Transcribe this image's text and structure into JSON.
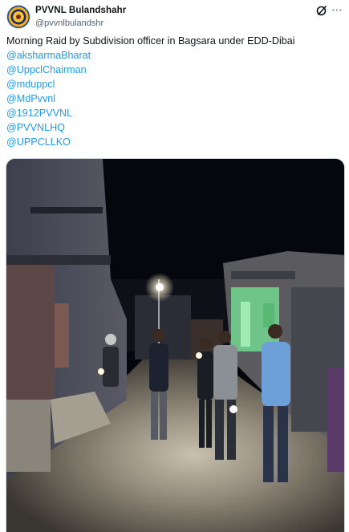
{
  "post": {
    "display_name": "PVVNL Bulandshahr",
    "handle": "@pvvnlbulandshr",
    "text": "Morning Raid by Subdivision officer in Bagsara under EDD-Dibai",
    "mentions": [
      "@aksharmaBharat",
      "@UppclChairman",
      "@mduppcl",
      "@MdPvvnl",
      "@1912PVVNL",
      "@PVVNLHQ",
      "@UPPCLLKO"
    ],
    "more_label": "⋯"
  },
  "icons": {
    "avatar": "pvvnl-logo",
    "grok": "grok-icon",
    "more": "more-icon"
  },
  "colors": {
    "link": "#1d9bf0",
    "text": "#0f1419",
    "secondary": "#536471"
  }
}
